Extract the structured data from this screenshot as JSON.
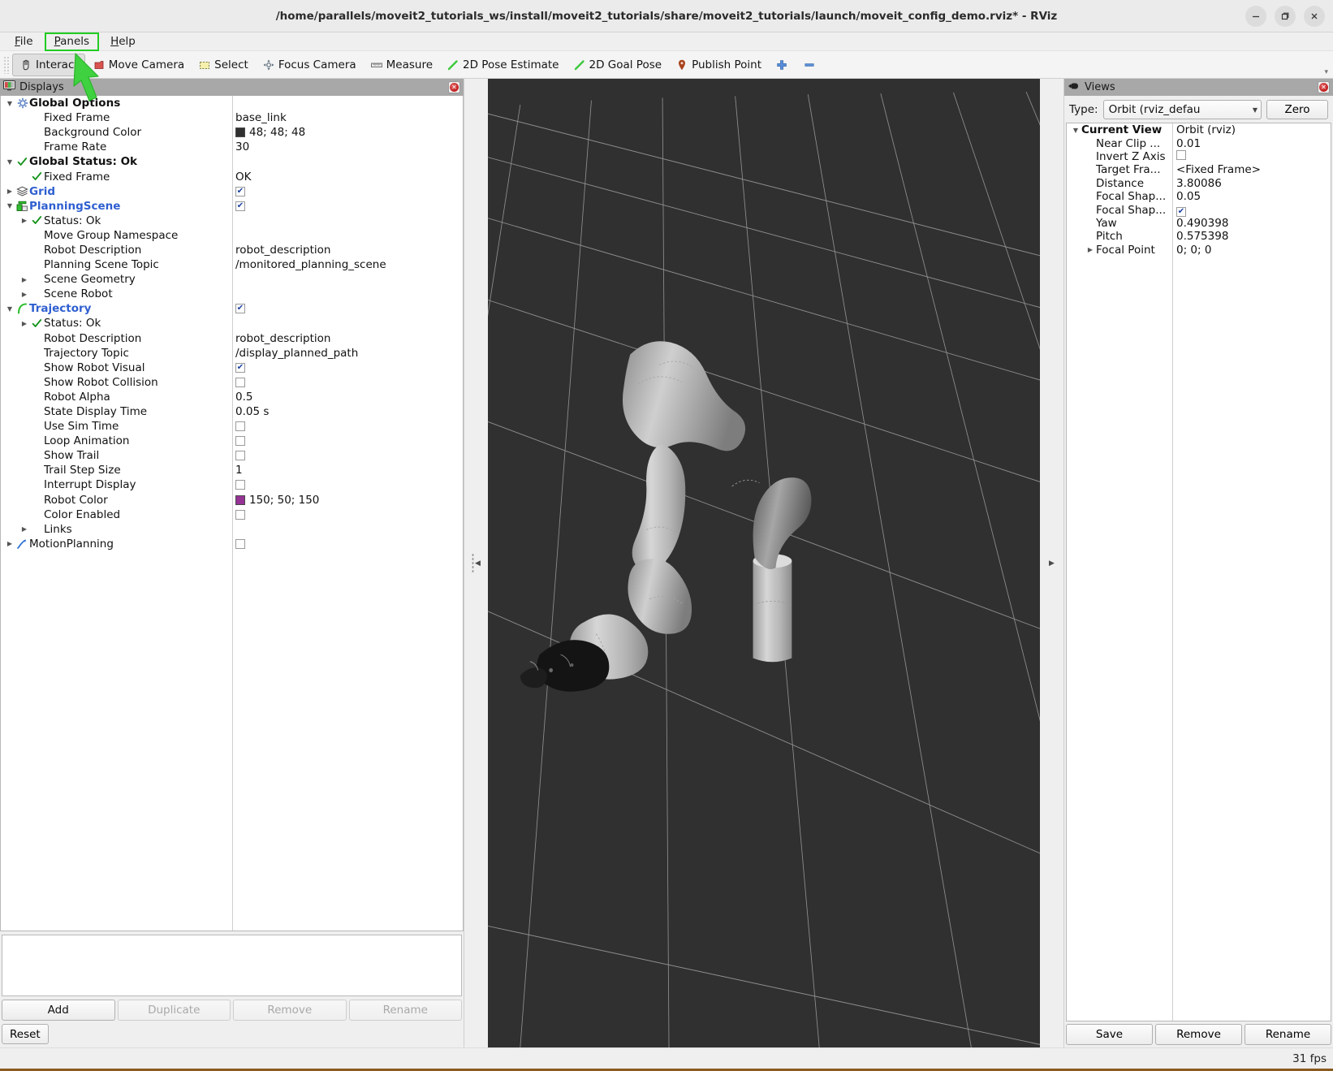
{
  "window": {
    "title": "/home/parallels/moveit2_tutorials_ws/install/moveit2_tutorials/share/moveit2_tutorials/launch/moveit_config_demo.rviz* - RViz",
    "minimize_label": "Minimize",
    "maximize_label": "Maximize",
    "close_label": "Close"
  },
  "menubar": {
    "items": [
      {
        "label": "File",
        "mnemonic": "F",
        "highlighted": false
      },
      {
        "label": "Panels",
        "mnemonic": "P",
        "highlighted": true
      },
      {
        "label": "Help",
        "mnemonic": "H",
        "highlighted": false
      }
    ]
  },
  "toolbar": {
    "buttons": [
      {
        "label": "Interact",
        "icon": "hand-cursor-icon",
        "active": true
      },
      {
        "label": "Move Camera",
        "icon": "move-camera-icon",
        "active": false
      },
      {
        "label": "Select",
        "icon": "select-rect-icon",
        "active": false
      },
      {
        "label": "Focus Camera",
        "icon": "focus-camera-icon",
        "active": false
      },
      {
        "label": "Measure",
        "icon": "ruler-icon",
        "active": false
      },
      {
        "label": "2D Pose Estimate",
        "icon": "pose-arrow-icon",
        "active": false
      },
      {
        "label": "2D Goal Pose",
        "icon": "goal-arrow-icon",
        "active": false
      },
      {
        "label": "Publish Point",
        "icon": "map-pin-icon",
        "active": false
      },
      {
        "label": "",
        "icon": "plus-icon",
        "active": false
      },
      {
        "label": "",
        "icon": "minus-icon",
        "active": false
      }
    ],
    "overflow_label": "▾"
  },
  "displays": {
    "panel_title": "Displays",
    "rows": [
      {
        "indent": 1,
        "expander": "down",
        "icon": "gear-icon",
        "label": "Global Options",
        "style": "bold",
        "value_type": "none",
        "value": ""
      },
      {
        "indent": 2,
        "expander": "none",
        "icon": "none",
        "label": "Fixed Frame",
        "style": "plain",
        "value_type": "text",
        "value": "base_link"
      },
      {
        "indent": 2,
        "expander": "none",
        "icon": "none",
        "label": "Background Color",
        "style": "plain",
        "value_type": "color",
        "value": "48; 48; 48",
        "color": "#303030"
      },
      {
        "indent": 2,
        "expander": "none",
        "icon": "none",
        "label": "Frame Rate",
        "style": "plain",
        "value_type": "text",
        "value": "30"
      },
      {
        "indent": 1,
        "expander": "down",
        "icon": "check-icon",
        "label": "Global Status: Ok",
        "style": "bold",
        "value_type": "none",
        "value": ""
      },
      {
        "indent": 2,
        "expander": "none",
        "icon": "check-icon",
        "label": "Fixed Frame",
        "style": "plain",
        "value_type": "text",
        "value": "OK"
      },
      {
        "indent": 1,
        "expander": "right",
        "icon": "grid-icon",
        "label": "Grid",
        "style": "link",
        "value_type": "checkbox",
        "value": "checked"
      },
      {
        "indent": 1,
        "expander": "down",
        "icon": "planning-scene-icon",
        "label": "PlanningScene",
        "style": "link",
        "value_type": "checkbox",
        "value": "checked"
      },
      {
        "indent": 2,
        "expander": "right",
        "icon": "check-icon",
        "label": "Status: Ok",
        "style": "plain",
        "value_type": "none",
        "value": ""
      },
      {
        "indent": 2,
        "expander": "none",
        "icon": "none",
        "label": "Move Group Namespace",
        "style": "plain",
        "value_type": "text",
        "value": ""
      },
      {
        "indent": 2,
        "expander": "none",
        "icon": "none",
        "label": "Robot Description",
        "style": "plain",
        "value_type": "text",
        "value": "robot_description"
      },
      {
        "indent": 2,
        "expander": "none",
        "icon": "none",
        "label": "Planning Scene Topic",
        "style": "plain",
        "value_type": "text",
        "value": "/monitored_planning_scene"
      },
      {
        "indent": 2,
        "expander": "right",
        "icon": "none",
        "label": "Scene Geometry",
        "style": "plain",
        "value_type": "none",
        "value": ""
      },
      {
        "indent": 2,
        "expander": "right",
        "icon": "none",
        "label": "Scene Robot",
        "style": "plain",
        "value_type": "none",
        "value": ""
      },
      {
        "indent": 1,
        "expander": "down",
        "icon": "trajectory-icon",
        "label": "Trajectory",
        "style": "link",
        "value_type": "checkbox",
        "value": "checked"
      },
      {
        "indent": 2,
        "expander": "right",
        "icon": "check-icon",
        "label": "Status: Ok",
        "style": "plain",
        "value_type": "none",
        "value": ""
      },
      {
        "indent": 2,
        "expander": "none",
        "icon": "none",
        "label": "Robot Description",
        "style": "plain",
        "value_type": "text",
        "value": "robot_description"
      },
      {
        "indent": 2,
        "expander": "none",
        "icon": "none",
        "label": "Trajectory Topic",
        "style": "plain",
        "value_type": "text",
        "value": "/display_planned_path"
      },
      {
        "indent": 2,
        "expander": "none",
        "icon": "none",
        "label": "Show Robot Visual",
        "style": "plain",
        "value_type": "checkbox",
        "value": "checked"
      },
      {
        "indent": 2,
        "expander": "none",
        "icon": "none",
        "label": "Show Robot Collision",
        "style": "plain",
        "value_type": "checkbox",
        "value": "unchecked"
      },
      {
        "indent": 2,
        "expander": "none",
        "icon": "none",
        "label": "Robot Alpha",
        "style": "plain",
        "value_type": "text",
        "value": "0.5"
      },
      {
        "indent": 2,
        "expander": "none",
        "icon": "none",
        "label": "State Display Time",
        "style": "plain",
        "value_type": "text",
        "value": "0.05 s"
      },
      {
        "indent": 2,
        "expander": "none",
        "icon": "none",
        "label": "Use Sim Time",
        "style": "plain",
        "value_type": "checkbox",
        "value": "unchecked"
      },
      {
        "indent": 2,
        "expander": "none",
        "icon": "none",
        "label": "Loop Animation",
        "style": "plain",
        "value_type": "checkbox",
        "value": "unchecked"
      },
      {
        "indent": 2,
        "expander": "none",
        "icon": "none",
        "label": "Show Trail",
        "style": "plain",
        "value_type": "checkbox",
        "value": "unchecked"
      },
      {
        "indent": 2,
        "expander": "none",
        "icon": "none",
        "label": "Trail Step Size",
        "style": "plain",
        "value_type": "text",
        "value": "1"
      },
      {
        "indent": 2,
        "expander": "none",
        "icon": "none",
        "label": "Interrupt Display",
        "style": "plain",
        "value_type": "checkbox",
        "value": "unchecked"
      },
      {
        "indent": 2,
        "expander": "none",
        "icon": "none",
        "label": "Robot Color",
        "style": "plain",
        "value_type": "color",
        "value": "150; 50; 150",
        "color": "#963296"
      },
      {
        "indent": 2,
        "expander": "none",
        "icon": "none",
        "label": "Color Enabled",
        "style": "plain",
        "value_type": "checkbox",
        "value": "unchecked"
      },
      {
        "indent": 2,
        "expander": "right",
        "icon": "none",
        "label": "Links",
        "style": "plain",
        "value_type": "none",
        "value": ""
      },
      {
        "indent": 1,
        "expander": "right",
        "icon": "motion-planning-icon",
        "label": "MotionPlanning",
        "style": "plain",
        "value_type": "checkbox",
        "value": "unchecked"
      }
    ],
    "buttons": [
      {
        "label": "Add",
        "enabled": true
      },
      {
        "label": "Duplicate",
        "enabled": false
      },
      {
        "label": "Remove",
        "enabled": false
      },
      {
        "label": "Rename",
        "enabled": false
      }
    ],
    "reset_label": "Reset"
  },
  "views": {
    "panel_title": "Views",
    "type_label": "Type:",
    "type_value": "Orbit (rviz_defau",
    "zero_label": "Zero",
    "rows": [
      {
        "indent": 1,
        "expander": "down",
        "label": "Current View",
        "style": "bold",
        "value_type": "text",
        "value": "Orbit (rviz)"
      },
      {
        "indent": 2,
        "expander": "none",
        "label": "Near Clip ...",
        "style": "plain",
        "value_type": "text",
        "value": "0.01"
      },
      {
        "indent": 2,
        "expander": "none",
        "label": "Invert Z Axis",
        "style": "plain",
        "value_type": "checkbox",
        "value": "unchecked"
      },
      {
        "indent": 2,
        "expander": "none",
        "label": "Target Fra...",
        "style": "plain",
        "value_type": "text",
        "value": "<Fixed Frame>"
      },
      {
        "indent": 2,
        "expander": "none",
        "label": "Distance",
        "style": "plain",
        "value_type": "text",
        "value": "3.80086"
      },
      {
        "indent": 2,
        "expander": "none",
        "label": "Focal Shap...",
        "style": "plain",
        "value_type": "text",
        "value": "0.05"
      },
      {
        "indent": 2,
        "expander": "none",
        "label": "Focal Shap...",
        "style": "plain",
        "value_type": "checkbox",
        "value": "checked"
      },
      {
        "indent": 2,
        "expander": "none",
        "label": "Yaw",
        "style": "plain",
        "value_type": "text",
        "value": "0.490398"
      },
      {
        "indent": 2,
        "expander": "none",
        "label": "Pitch",
        "style": "plain",
        "value_type": "text",
        "value": "0.575398"
      },
      {
        "indent": 2,
        "expander": "right",
        "label": "Focal Point",
        "style": "plain",
        "value_type": "text",
        "value": "0; 0; 0"
      }
    ],
    "buttons": [
      {
        "label": "Save"
      },
      {
        "label": "Remove"
      },
      {
        "label": "Rename"
      }
    ]
  },
  "statusbar": {
    "message": "",
    "fps": "31 fps"
  },
  "viewport": {
    "background_color": "#303030",
    "grid_color": "#b4b4b4",
    "robot_color": "#c8c8c8",
    "gripper_color": "#1a1a1a"
  },
  "annotation": {
    "arrow_color": "#3fd13f",
    "highlight_color": "#22cc22",
    "target": "Panels"
  }
}
